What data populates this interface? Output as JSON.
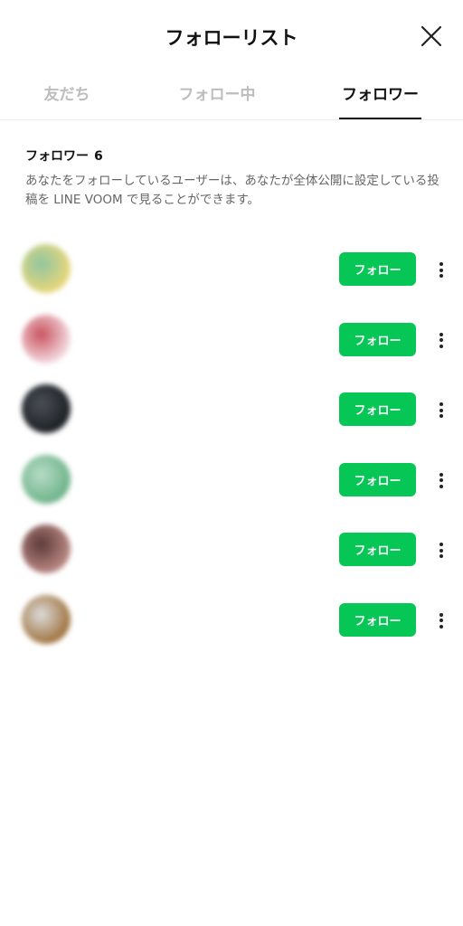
{
  "header": {
    "title": "フォローリスト"
  },
  "tabs": [
    {
      "label": "友だち",
      "active": false
    },
    {
      "label": "フォロー中",
      "active": false
    },
    {
      "label": "フォロワー",
      "active": true
    }
  ],
  "section": {
    "title": "フォロワー",
    "count": "6",
    "description": "あなたをフォローしているユーザーは、あなたが全体公開に設定している投稿を LINE VOOM で見ることができます。"
  },
  "followers": [
    {
      "name": "",
      "follow_label": "フォロー",
      "avatar_colors": [
        "#e8d67a",
        "#8fc6a0"
      ]
    },
    {
      "name": "",
      "follow_label": "フォロー",
      "avatar_colors": [
        "#f3d9df",
        "#c9535f"
      ]
    },
    {
      "name": "",
      "follow_label": "フォロー",
      "avatar_colors": [
        "#1d2024",
        "#4a4f57"
      ]
    },
    {
      "name": "",
      "follow_label": "フォロー",
      "avatar_colors": [
        "#6fb38a",
        "#b7dcc7"
      ]
    },
    {
      "name": "",
      "follow_label": "フォロー",
      "avatar_colors": [
        "#b98884",
        "#5c3a38"
      ]
    },
    {
      "name": "",
      "follow_label": "フォロー",
      "avatar_colors": [
        "#a0743f",
        "#dcdcdc"
      ]
    }
  ],
  "colors": {
    "accent": "#06c755",
    "tab_inactive": "#bdbdbd",
    "divider": "#ececec"
  }
}
